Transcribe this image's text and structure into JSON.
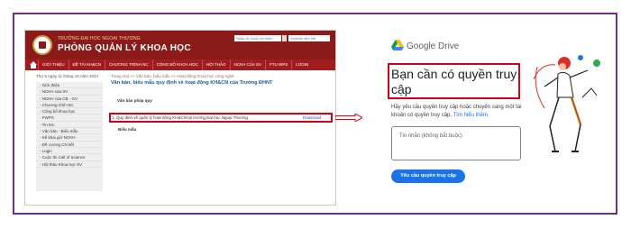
{
  "university_site": {
    "univ_name": "TRƯỜNG ĐẠI HỌC NGOẠI THƯƠNG",
    "dept_name": "PHÒNG QUẢN LÝ KHOA HỌC",
    "search_placeholder_1": "Nhập từ khoá tìm kiếm",
    "search_placeholder_2": "Website liên kết",
    "nav": [
      "GIỚI THIỆU",
      "ĐỀ TÀI KH&CN",
      "CHƯƠNG TRÌNH NC",
      "CÔNG BỐ KHOA HỌC",
      "HỘI THẢO",
      "NCKH CỦA SV",
      "FTU WPS",
      "LOGIN"
    ],
    "date": "Thứ 6 ngày 11 tháng 10 năm 2024",
    "sidebar": [
      "Giới thiệu",
      "NCKH của SV",
      "NCKH của CB - GV",
      "Chương trình NC",
      "Công bố khoa học",
      "FWPS",
      "Tin tức",
      "Văn bản - Biểu mẫu",
      "Kế khai giờ NCKH",
      "Đề cương CN kết",
      "Login",
      "Cuộc thi Call of Science",
      "Hội thảo Khoa học SV"
    ],
    "breadcrumb": "Trang chủ >> Văn bản, biểu mẫu >> Hoạt động Khoa học công nghệ",
    "page_title": "Văn bản, biểu mẫu quy định về hoạt động KH&CN của Trường ĐHNT",
    "section_docs": "Văn bản pháp quy",
    "doc_item": "1.  Quy định về quản lý hoạt động KH&CN tại trường Đại học Ngoại Thương",
    "doc_download": "Download",
    "section_forms": "Biểu mẫu"
  },
  "google_drive": {
    "brand": "Google Drive",
    "title": "Bạn cần có quyền truy cập",
    "description": "Hãy yêu cầu quyền truy cập hoặc chuyển sang một tài khoản có quyền truy cập.",
    "learn_more": "Tìm hiểu thêm",
    "message_placeholder": "Tin nhắn (không bắt buộc)",
    "request_button": "Yêu cầu quyền truy cập"
  },
  "colors": {
    "frame": "#6b2f8e",
    "site_header": "#8b1a1a",
    "highlight": "#d0021b",
    "drive_blue": "#1a73e8"
  }
}
